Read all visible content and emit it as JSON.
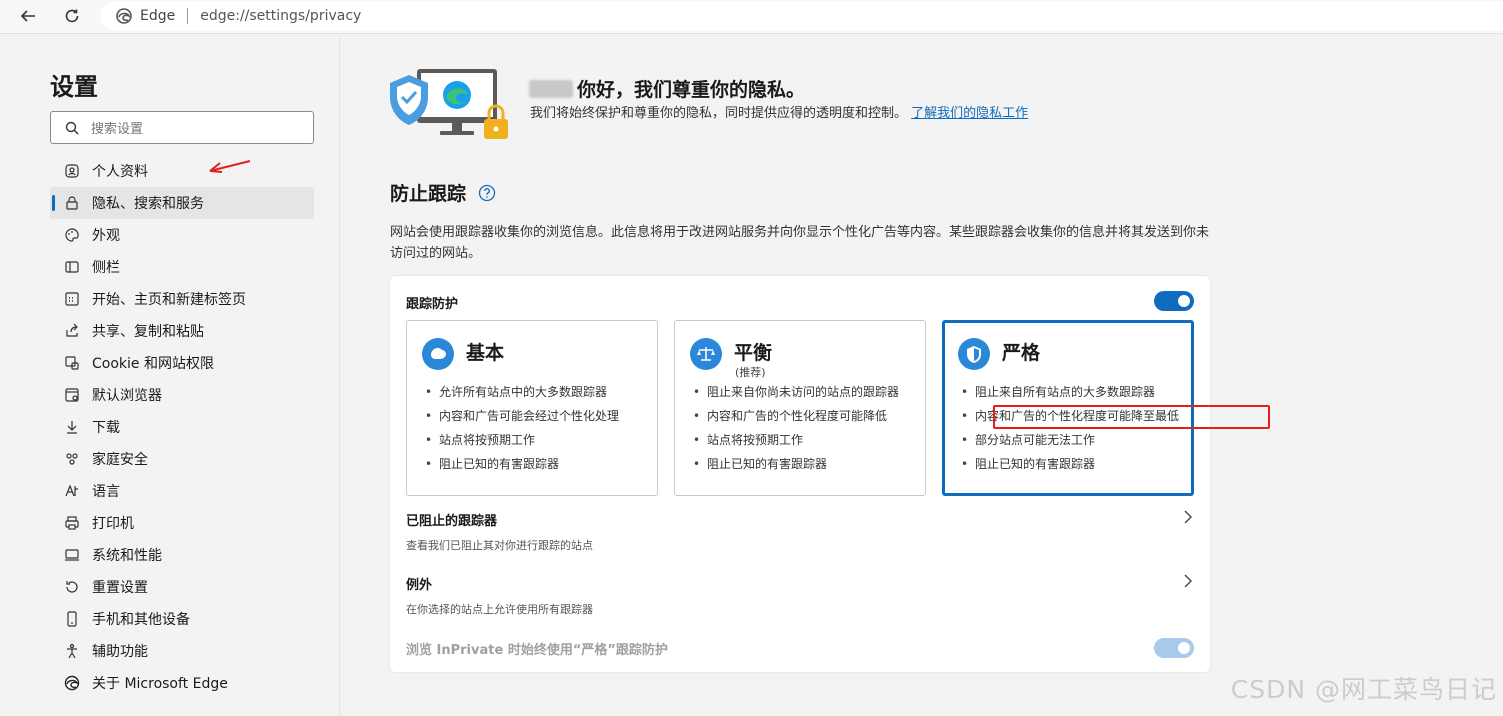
{
  "browser": {
    "back_icon": "arrow-left-icon",
    "refresh_icon": "refresh-icon",
    "site_name": "Edge",
    "url": "edge://settings/privacy"
  },
  "sidebar": {
    "title": "设置",
    "search_placeholder": "搜索设置",
    "items": [
      {
        "label": "个人资料",
        "icon": "profile-icon"
      },
      {
        "label": "隐私、搜索和服务",
        "icon": "lock-icon",
        "active": true
      },
      {
        "label": "外观",
        "icon": "palette-icon"
      },
      {
        "label": "侧栏",
        "icon": "sidebar-icon"
      },
      {
        "label": "开始、主页和新建标签页",
        "icon": "home-icon"
      },
      {
        "label": "共享、复制和粘贴",
        "icon": "share-icon"
      },
      {
        "label": "Cookie 和网站权限",
        "icon": "cookie-icon"
      },
      {
        "label": "默认浏览器",
        "icon": "browser-icon"
      },
      {
        "label": "下载",
        "icon": "download-icon"
      },
      {
        "label": "家庭安全",
        "icon": "family-icon"
      },
      {
        "label": "语言",
        "icon": "language-icon"
      },
      {
        "label": "打印机",
        "icon": "printer-icon"
      },
      {
        "label": "系统和性能",
        "icon": "system-icon"
      },
      {
        "label": "重置设置",
        "icon": "reset-icon"
      },
      {
        "label": "手机和其他设备",
        "icon": "phone-icon"
      },
      {
        "label": "辅助功能",
        "icon": "accessibility-icon"
      },
      {
        "label": "关于 Microsoft Edge",
        "icon": "edge-icon"
      }
    ]
  },
  "hero": {
    "greeting": "你好，我们尊重你的隐私。",
    "description": "我们将始终保护和尊重你的隐私，同时提供应得的透明度和控制。",
    "link": "了解我们的隐私工作"
  },
  "tracking": {
    "title": "防止跟踪",
    "description": "网站会使用跟踪器收集你的浏览信息。此信息将用于改进网站服务并向你显示个性化广告等内容。某些跟踪器会收集你的信息并将其发送到你未访问过的网站。",
    "card_label": "跟踪防护",
    "toggle_on": true,
    "options": [
      {
        "name": "基本",
        "sub": "",
        "icon": "basic-shield-icon",
        "bullets": [
          "允许所有站点中的大多数跟踪器",
          "内容和广告可能会经过个性化处理",
          "站点将按预期工作",
          "阻止已知的有害跟踪器"
        ]
      },
      {
        "name": "平衡",
        "sub": "(推荐)",
        "icon": "balance-scale-icon",
        "bullets": [
          "阻止来自你尚未访问的站点的跟踪器",
          "内容和广告的个性化程度可能降低",
          "站点将按预期工作",
          "阻止已知的有害跟踪器"
        ]
      },
      {
        "name": "严格",
        "sub": "",
        "icon": "strict-shield-icon",
        "selected": true,
        "bullets": [
          "阻止来自所有站点的大多数跟踪器",
          "内容和广告的个性化程度可能降至最低",
          "部分站点可能无法工作",
          "阻止已知的有害跟踪器"
        ]
      }
    ],
    "blocked": {
      "title": "已阻止的跟踪器",
      "desc": "查看我们已阻止其对你进行跟踪的站点"
    },
    "exceptions": {
      "title": "例外",
      "desc": "在你选择的站点上允许使用所有跟踪器"
    },
    "inprivate": {
      "title": "浏览 InPrivate 时始终使用“严格”跟踪防护"
    }
  },
  "watermark": "CSDN @网工菜鸟日记",
  "colors": {
    "accent": "#0f6cbd",
    "annotation": "#e02020"
  }
}
